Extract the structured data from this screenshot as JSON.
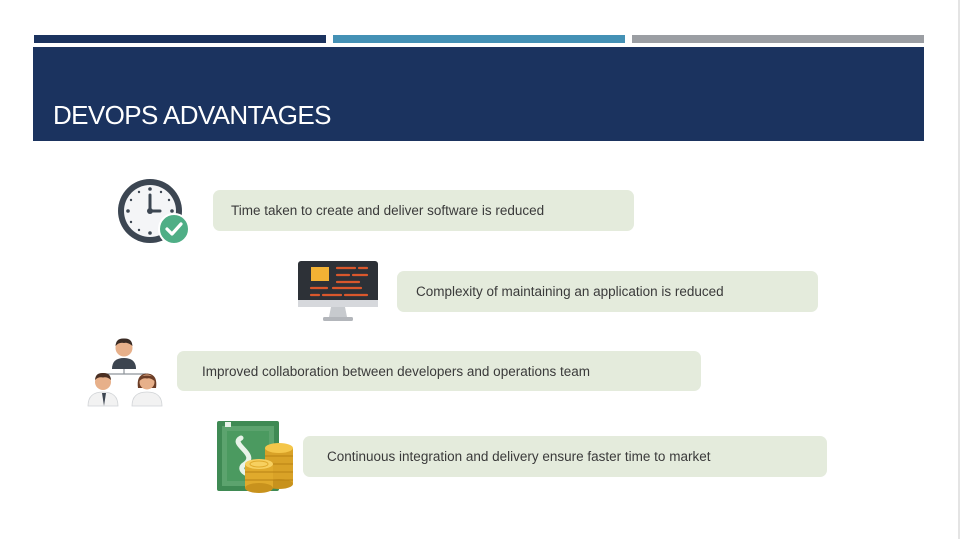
{
  "slide": {
    "title": "DEVOPS ADVANTAGES",
    "advantages": [
      {
        "text": "Time taken to create and deliver software is reduced",
        "icon": "clock-check-icon"
      },
      {
        "text": "Complexity of maintaining an application is reduced",
        "icon": "monitor-code-icon"
      },
      {
        "text": "Improved collaboration between developers and operations team",
        "icon": "team-icon"
      },
      {
        "text": "Continuous integration and delivery ensure faster time to market",
        "icon": "money-coins-icon"
      }
    ]
  },
  "colors": {
    "header_bg": "#1b335f",
    "accent_blue": "#4491b5",
    "accent_gray": "#9b9ea3",
    "item_bg": "#e4ebdc",
    "text": "#3a3a3a"
  }
}
